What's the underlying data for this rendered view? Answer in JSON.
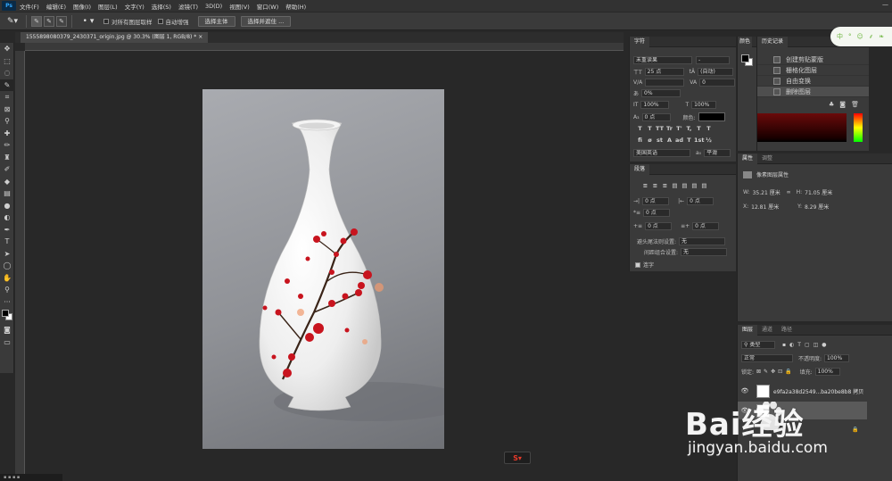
{
  "menu": {
    "items": [
      "文件(F)",
      "编辑(E)",
      "图像(I)",
      "图层(L)",
      "文字(Y)",
      "选择(S)",
      "滤镜(T)",
      "3D(D)",
      "视图(V)",
      "窗口(W)",
      "帮助(H)"
    ]
  },
  "options": {
    "sample_all_layers": "对所有图层取样",
    "auto_enhance": "自动增强",
    "select_subject": "选择主体",
    "select_and_mask": "选择并遮住 ..."
  },
  "document": {
    "tab_title": "1555898080379_2430371_origin.jpg @ 30.3% (图层 1, RGB/8) *"
  },
  "character": {
    "tab": "字符",
    "font_family": "未重读果",
    "font_style": "-",
    "size": "25 点",
    "leading": "(自动)",
    "kerning": "",
    "tracking": "0",
    "scale_v": "100%",
    "scale_h": "100%",
    "baseline": "0 点",
    "color_label": "颜色:",
    "tracking_percent": "0%",
    "language": "美国英语",
    "antialias": "平滑",
    "type_buttons": [
      "T",
      "T",
      "TT",
      "Tr",
      "T'",
      "T,",
      "T",
      "T"
    ]
  },
  "paragraph": {
    "tab": "段落",
    "indent_left": "0 点",
    "indent_right": "0 点",
    "indent_first": "0 点",
    "space_before": "0 点",
    "space_after": "0 点",
    "kinsoku_label": "避头尾法则设置:",
    "kinsoku_value": "无",
    "mojikumi_label": "间距组合设置:",
    "mojikumi_value": "无",
    "hyphenate_label": "连字"
  },
  "swatch": {
    "tab": "颜色"
  },
  "history": {
    "tab": "历史记录",
    "items": [
      "创建剪贴蒙版",
      "栅格化图层",
      "自由变换",
      "删除图层"
    ]
  },
  "properties": {
    "tabs": [
      "属性",
      "调整"
    ],
    "header": "像素图层属性",
    "w_label": "W:",
    "w_value": "35.21 厘米",
    "h_label": "H:",
    "h_value": "71.05 厘米",
    "x_label": "X:",
    "x_value": "12.81 厘米",
    "y_label": "Y:",
    "y_value": "8.29 厘米"
  },
  "layers": {
    "tabs": [
      "图层",
      "通道",
      "路径"
    ],
    "filter_kind": "类型",
    "blend_mode": "正常",
    "opacity_label": "不透明度:",
    "opacity_value": "100%",
    "lock_label": "锁定:",
    "fill_label": "填充:",
    "fill_value": "100%",
    "layer_name": "e9fa2a38d2549...ba20be8b8 拷贝"
  },
  "float_toolbar": {
    "items": [
      "中",
      "°",
      "☺",
      "⸙",
      "❧"
    ]
  },
  "watermark": {
    "brand": "Bai经验",
    "url": "jingyan.baidu.com"
  },
  "colors": {
    "accent": "#31a8ff",
    "vase_flower": "#c8141e"
  }
}
